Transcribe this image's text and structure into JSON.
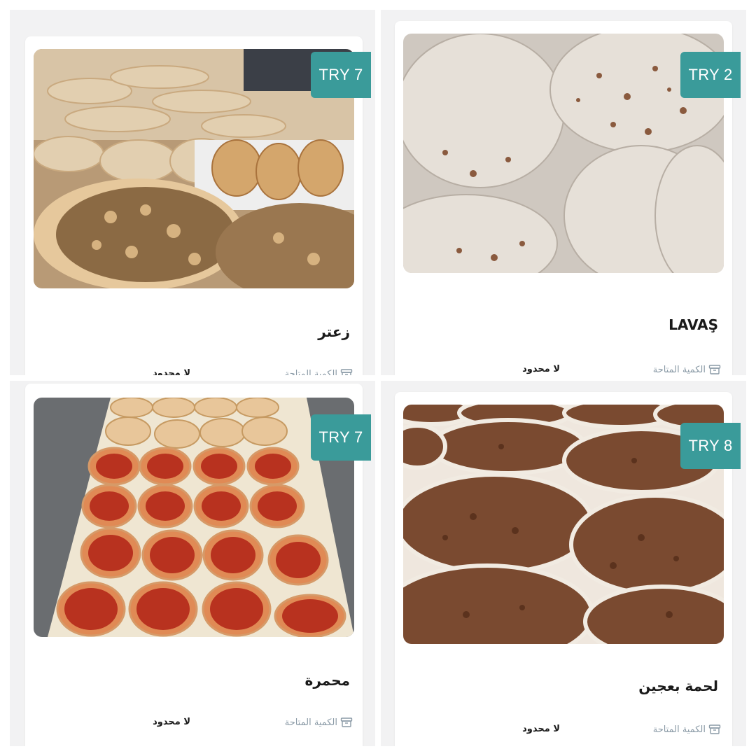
{
  "products": [
    {
      "id": "zaatar",
      "title": "زعتر",
      "badge": "TRY 7",
      "qty_label": "الكمية المتاحة",
      "qty_value": "لا محدود"
    },
    {
      "id": "lavas",
      "title": "LAVAŞ",
      "badge": "TRY 2",
      "qty_label": "الكمية المتاحة",
      "qty_value": "لا محدود"
    },
    {
      "id": "muhammara",
      "title": "محمرة",
      "badge": "TRY 7",
      "qty_label": "الكمية المتاحة",
      "qty_value": "لا محدود"
    },
    {
      "id": "lahmacun",
      "title": "لحمة بعجين",
      "badge": "TRY 8",
      "qty_label": "الكمية المتاحة",
      "qty_value": "لا محدود"
    }
  ],
  "colors": {
    "badge": "#3a9b9a",
    "panel": "#f2f2f3"
  },
  "icons": {
    "quantity": "archive-box-icon"
  }
}
